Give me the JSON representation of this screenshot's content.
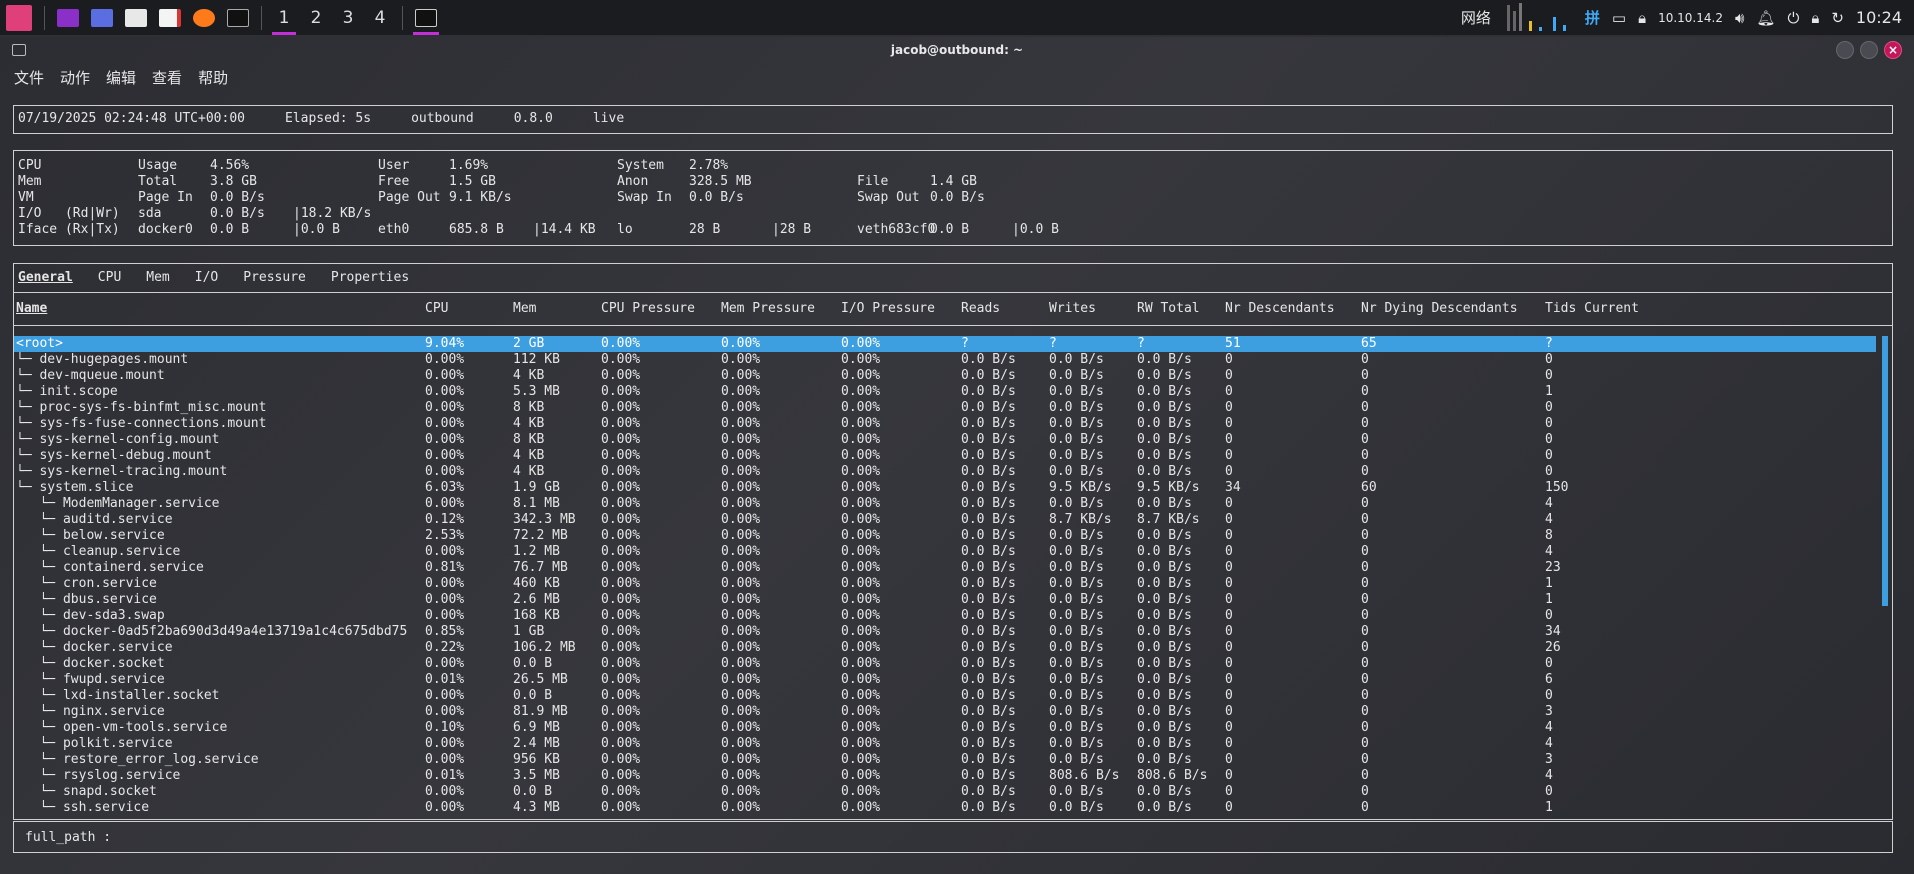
{
  "taskbar": {
    "workspaces": [
      "1",
      "2",
      "3",
      "4"
    ],
    "network_label": "网络",
    "ime_label": "拼",
    "ip": "10.10.14.2",
    "clock": "10:24",
    "colors": {
      "accent": "#c42fd8",
      "bg": "#1b1c20"
    }
  },
  "window": {
    "title": "jacob@outbound: ~",
    "menu": [
      "文件",
      "动作",
      "编辑",
      "查看",
      "帮助"
    ]
  },
  "header": {
    "datetime": "07/19/2025 02:24:48 UTC+00:00",
    "elapsed": "Elapsed: 5s",
    "host": "outbound",
    "version": "0.8.0",
    "mode": "live"
  },
  "system": {
    "cpu": {
      "label": "CPU",
      "usage_k": "Usage",
      "usage_v": "4.56%",
      "user_k": "User",
      "user_v": "1.69%",
      "system_k": "System",
      "system_v": "2.78%"
    },
    "mem": {
      "label": "Mem",
      "total_k": "Total",
      "total_v": "3.8 GB",
      "free_k": "Free",
      "free_v": "1.5 GB",
      "anon_k": "Anon",
      "anon_v": "328.5 MB",
      "file_k": "File",
      "file_v": "1.4 GB"
    },
    "vm": {
      "label": "VM",
      "pagein_k": "Page In",
      "pagein_v": "0.0 B/s",
      "pageout_k": "Page Out",
      "pageout_v": "9.1 KB/s",
      "swapin_k": "Swap In",
      "swapin_v": "0.0 B/s",
      "swapout_k": "Swap Out",
      "swapout_v": "0.0 B/s"
    },
    "io": {
      "label": "I/O   (Rd|Wr)",
      "dev": "sda",
      "rd": "0.0 B/s",
      "wr": "|18.2 KB/s"
    },
    "iface": {
      "label": "Iface (Rx|Tx)",
      "items": [
        {
          "name": "docker0",
          "rx": "0.0 B",
          "tx": "|0.0 B"
        },
        {
          "name": "eth0",
          "rx": "685.8 B",
          "tx": "|14.4 KB"
        },
        {
          "name": "lo",
          "rx": "28 B",
          "tx": "|28 B"
        },
        {
          "name": "veth683cf0",
          "rx": "0.0 B",
          "tx": "|0.0 B"
        }
      ]
    }
  },
  "tabs": [
    "General",
    "CPU",
    "Mem",
    "I/O",
    "Pressure",
    "Properties"
  ],
  "columns": [
    "Name",
    "CPU",
    "Mem",
    "CPU Pressure",
    "Mem Pressure",
    "I/O Pressure",
    "Reads",
    "Writes",
    "RW Total",
    "Nr Descendants",
    "Nr Dying Descendants",
    "Tids Current"
  ],
  "rows": [
    [
      "<root>",
      "9.04%",
      "2 GB",
      "0.00%",
      "0.00%",
      "0.00%",
      "?",
      "?",
      "?",
      "51",
      "65",
      "?"
    ],
    [
      "└─ dev-hugepages.mount",
      "0.00%",
      "112 KB",
      "0.00%",
      "0.00%",
      "0.00%",
      "0.0 B/s",
      "0.0 B/s",
      "0.0 B/s",
      "0",
      "0",
      "0"
    ],
    [
      "└─ dev-mqueue.mount",
      "0.00%",
      "4 KB",
      "0.00%",
      "0.00%",
      "0.00%",
      "0.0 B/s",
      "0.0 B/s",
      "0.0 B/s",
      "0",
      "0",
      "0"
    ],
    [
      "└─ init.scope",
      "0.00%",
      "5.3 MB",
      "0.00%",
      "0.00%",
      "0.00%",
      "0.0 B/s",
      "0.0 B/s",
      "0.0 B/s",
      "0",
      "0",
      "1"
    ],
    [
      "└─ proc-sys-fs-binfmt_misc.mount",
      "0.00%",
      "8 KB",
      "0.00%",
      "0.00%",
      "0.00%",
      "0.0 B/s",
      "0.0 B/s",
      "0.0 B/s",
      "0",
      "0",
      "0"
    ],
    [
      "└─ sys-fs-fuse-connections.mount",
      "0.00%",
      "4 KB",
      "0.00%",
      "0.00%",
      "0.00%",
      "0.0 B/s",
      "0.0 B/s",
      "0.0 B/s",
      "0",
      "0",
      "0"
    ],
    [
      "└─ sys-kernel-config.mount",
      "0.00%",
      "8 KB",
      "0.00%",
      "0.00%",
      "0.00%",
      "0.0 B/s",
      "0.0 B/s",
      "0.0 B/s",
      "0",
      "0",
      "0"
    ],
    [
      "└─ sys-kernel-debug.mount",
      "0.00%",
      "4 KB",
      "0.00%",
      "0.00%",
      "0.00%",
      "0.0 B/s",
      "0.0 B/s",
      "0.0 B/s",
      "0",
      "0",
      "0"
    ],
    [
      "└─ sys-kernel-tracing.mount",
      "0.00%",
      "4 KB",
      "0.00%",
      "0.00%",
      "0.00%",
      "0.0 B/s",
      "0.0 B/s",
      "0.0 B/s",
      "0",
      "0",
      "0"
    ],
    [
      "└─ system.slice",
      "6.03%",
      "1.9 GB",
      "0.00%",
      "0.00%",
      "0.00%",
      "0.0 B/s",
      "9.5 KB/s",
      "9.5 KB/s",
      "34",
      "60",
      "150"
    ],
    [
      "   └─ ModemManager.service",
      "0.00%",
      "8.1 MB",
      "0.00%",
      "0.00%",
      "0.00%",
      "0.0 B/s",
      "0.0 B/s",
      "0.0 B/s",
      "0",
      "0",
      "4"
    ],
    [
      "   └─ auditd.service",
      "0.12%",
      "342.3 MB",
      "0.00%",
      "0.00%",
      "0.00%",
      "0.0 B/s",
      "8.7 KB/s",
      "8.7 KB/s",
      "0",
      "0",
      "4"
    ],
    [
      "   └─ below.service",
      "2.53%",
      "72.2 MB",
      "0.00%",
      "0.00%",
      "0.00%",
      "0.0 B/s",
      "0.0 B/s",
      "0.0 B/s",
      "0",
      "0",
      "8"
    ],
    [
      "   └─ cleanup.service",
      "0.00%",
      "1.2 MB",
      "0.00%",
      "0.00%",
      "0.00%",
      "0.0 B/s",
      "0.0 B/s",
      "0.0 B/s",
      "0",
      "0",
      "4"
    ],
    [
      "   └─ containerd.service",
      "0.81%",
      "76.7 MB",
      "0.00%",
      "0.00%",
      "0.00%",
      "0.0 B/s",
      "0.0 B/s",
      "0.0 B/s",
      "0",
      "0",
      "23"
    ],
    [
      "   └─ cron.service",
      "0.00%",
      "460 KB",
      "0.00%",
      "0.00%",
      "0.00%",
      "0.0 B/s",
      "0.0 B/s",
      "0.0 B/s",
      "0",
      "0",
      "1"
    ],
    [
      "   └─ dbus.service",
      "0.00%",
      "2.6 MB",
      "0.00%",
      "0.00%",
      "0.00%",
      "0.0 B/s",
      "0.0 B/s",
      "0.0 B/s",
      "0",
      "0",
      "1"
    ],
    [
      "   └─ dev-sda3.swap",
      "0.00%",
      "168 KB",
      "0.00%",
      "0.00%",
      "0.00%",
      "0.0 B/s",
      "0.0 B/s",
      "0.0 B/s",
      "0",
      "0",
      "0"
    ],
    [
      "   └─ docker-0ad5f2ba690d3d49a4e13719a1c4c675dbd75",
      "0.85%",
      "1 GB",
      "0.00%",
      "0.00%",
      "0.00%",
      "0.0 B/s",
      "0.0 B/s",
      "0.0 B/s",
      "0",
      "0",
      "34"
    ],
    [
      "   └─ docker.service",
      "0.22%",
      "106.2 MB",
      "0.00%",
      "0.00%",
      "0.00%",
      "0.0 B/s",
      "0.0 B/s",
      "0.0 B/s",
      "0",
      "0",
      "26"
    ],
    [
      "   └─ docker.socket",
      "0.00%",
      "0.0 B",
      "0.00%",
      "0.00%",
      "0.00%",
      "0.0 B/s",
      "0.0 B/s",
      "0.0 B/s",
      "0",
      "0",
      "0"
    ],
    [
      "   └─ fwupd.service",
      "0.01%",
      "26.5 MB",
      "0.00%",
      "0.00%",
      "0.00%",
      "0.0 B/s",
      "0.0 B/s",
      "0.0 B/s",
      "0",
      "0",
      "6"
    ],
    [
      "   └─ lxd-installer.socket",
      "0.00%",
      "0.0 B",
      "0.00%",
      "0.00%",
      "0.00%",
      "0.0 B/s",
      "0.0 B/s",
      "0.0 B/s",
      "0",
      "0",
      "0"
    ],
    [
      "   └─ nginx.service",
      "0.00%",
      "81.9 MB",
      "0.00%",
      "0.00%",
      "0.00%",
      "0.0 B/s",
      "0.0 B/s",
      "0.0 B/s",
      "0",
      "0",
      "3"
    ],
    [
      "   └─ open-vm-tools.service",
      "0.10%",
      "6.9 MB",
      "0.00%",
      "0.00%",
      "0.00%",
      "0.0 B/s",
      "0.0 B/s",
      "0.0 B/s",
      "0",
      "0",
      "4"
    ],
    [
      "   └─ polkit.service",
      "0.00%",
      "2.4 MB",
      "0.00%",
      "0.00%",
      "0.00%",
      "0.0 B/s",
      "0.0 B/s",
      "0.0 B/s",
      "0",
      "0",
      "4"
    ],
    [
      "   └─ restore_error_log.service",
      "0.00%",
      "956 KB",
      "0.00%",
      "0.00%",
      "0.00%",
      "0.0 B/s",
      "0.0 B/s",
      "0.0 B/s",
      "0",
      "0",
      "3"
    ],
    [
      "   └─ rsyslog.service",
      "0.01%",
      "3.5 MB",
      "0.00%",
      "0.00%",
      "0.00%",
      "0.0 B/s",
      "808.6 B/s",
      "808.6 B/s",
      "0",
      "0",
      "4"
    ],
    [
      "   └─ snapd.socket",
      "0.00%",
      "0.0 B",
      "0.00%",
      "0.00%",
      "0.00%",
      "0.0 B/s",
      "0.0 B/s",
      "0.0 B/s",
      "0",
      "0",
      "0"
    ],
    [
      "   └─ ssh.service",
      "0.00%",
      "4.3 MB",
      "0.00%",
      "0.00%",
      "0.00%",
      "0.0 B/s",
      "0.0 B/s",
      "0.0 B/s",
      "0",
      "0",
      "1"
    ]
  ],
  "footer": {
    "label": "full_path :"
  },
  "colors": {
    "selection": "#3d9ee0",
    "border": "#d0d0d0",
    "close": "#c2185b"
  }
}
